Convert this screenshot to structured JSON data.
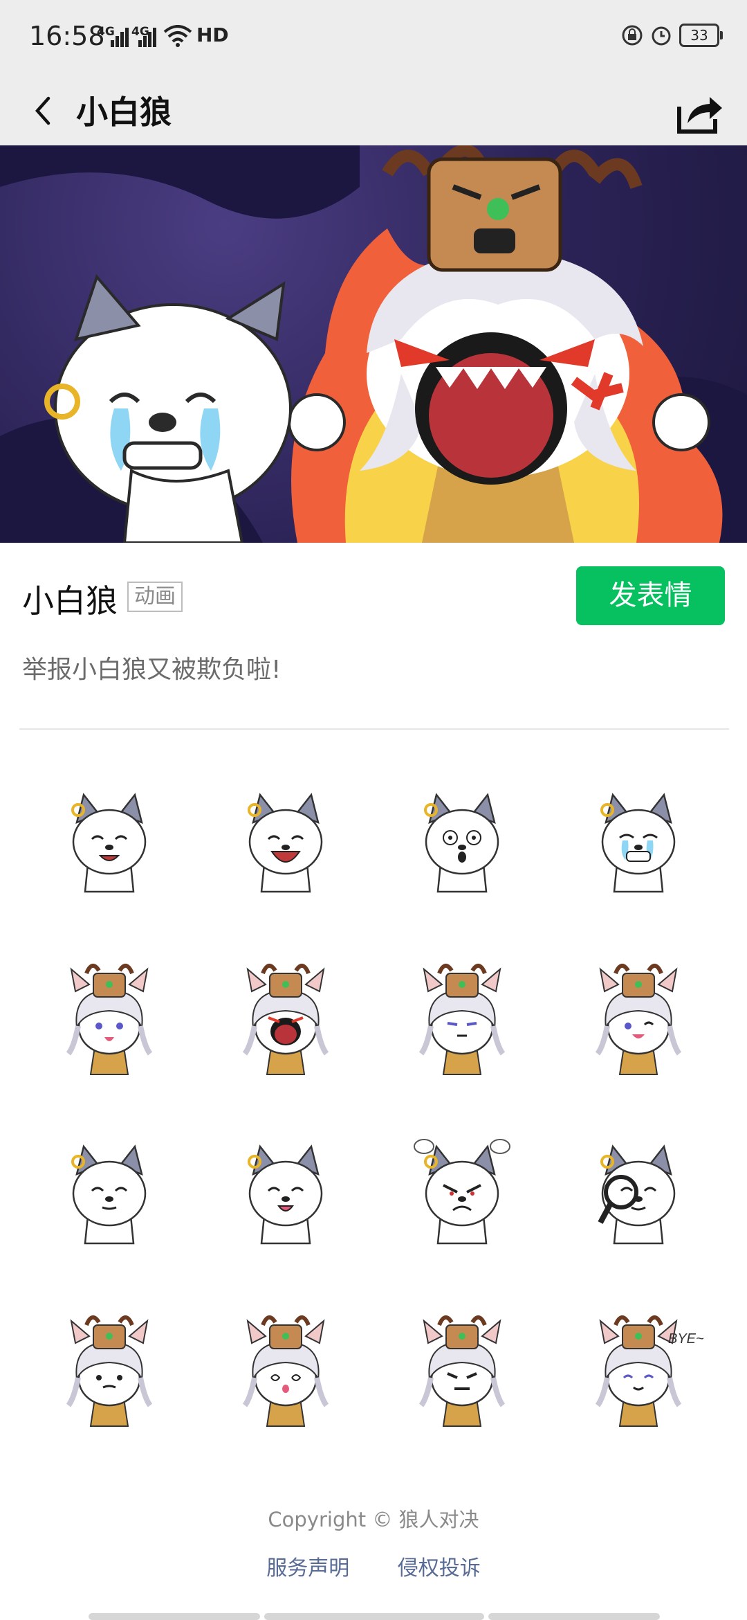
{
  "status": {
    "time": "16:58",
    "sig1": "4G",
    "sig2": "4G",
    "hd": "HD",
    "battery": "33"
  },
  "nav": {
    "title": "小白狼",
    "back_icon": "chevron-left-icon",
    "share_icon": "share-icon"
  },
  "pack": {
    "title": "小白狼",
    "tag": "动画",
    "send_label": "发表情",
    "description": "举报小白狼又被欺负啦!"
  },
  "stickers": [
    {
      "type": "wolf",
      "mood": "wink"
    },
    {
      "type": "wolf",
      "mood": "laugh"
    },
    {
      "type": "wolf",
      "mood": "shock"
    },
    {
      "type": "wolf",
      "mood": "cry"
    },
    {
      "type": "girl",
      "mood": "tongue"
    },
    {
      "type": "girl",
      "mood": "angry-roar"
    },
    {
      "type": "girl",
      "mood": "annoyed"
    },
    {
      "type": "girl",
      "mood": "happy"
    },
    {
      "type": "wolf",
      "mood": "think"
    },
    {
      "type": "wolf",
      "mood": "peace"
    },
    {
      "type": "wolf",
      "mood": "furious"
    },
    {
      "type": "wolf",
      "mood": "magnify"
    },
    {
      "type": "girl",
      "mood": "confused"
    },
    {
      "type": "girl",
      "mood": "dizzy"
    },
    {
      "type": "girl",
      "mood": "grumpy"
    },
    {
      "type": "girl",
      "mood": "bye",
      "caption": "BYE~"
    }
  ],
  "footer": {
    "copyright": "Copyright © 狼人对决",
    "link1": "服务声明",
    "link2": "侵权投诉"
  },
  "colors": {
    "accent": "#07c160",
    "link": "#576b95"
  }
}
